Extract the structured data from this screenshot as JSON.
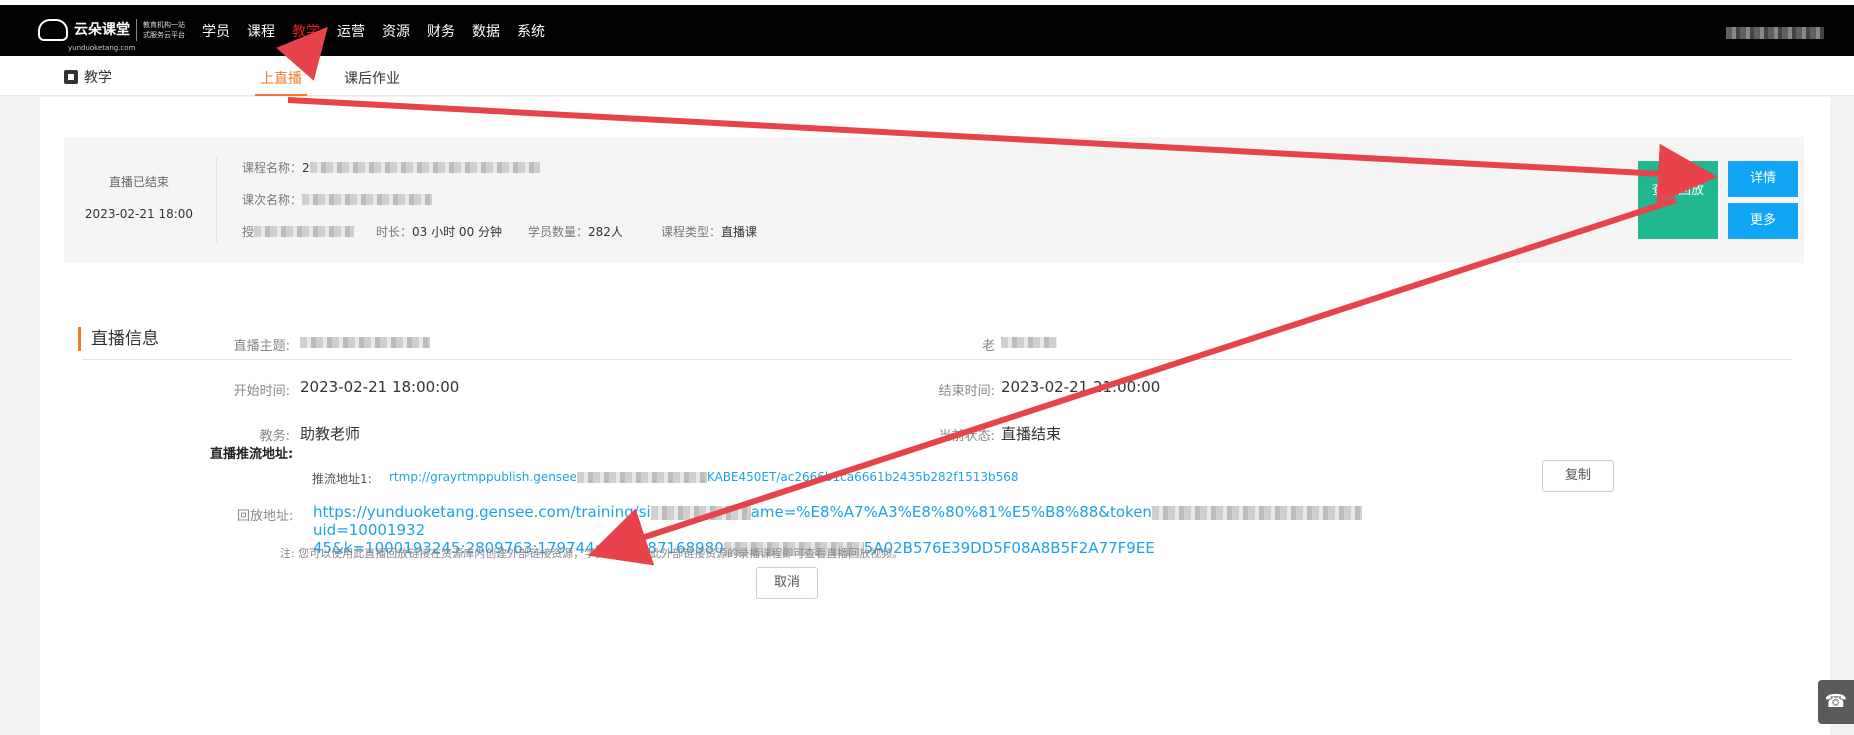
{
  "topbar": {
    "brand": "云朵课堂",
    "brand_sub": "yunduoketang.com",
    "slogan": "教育机构一站式服务云平台",
    "nav": [
      "学员",
      "课程",
      "教学",
      "运营",
      "资源",
      "财务",
      "数据",
      "系统"
    ],
    "active_nav": "教学"
  },
  "subbar": {
    "title": "教学",
    "tabs": [
      "上直播",
      "课后作业"
    ],
    "active_tab": "上直播"
  },
  "card": {
    "status": "直播已结束",
    "time": "2023-02-21 18:00",
    "course_name_label": "课程名称：",
    "course_name_value": "2",
    "session_name_label": "课次名称：",
    "teacher_label": "授",
    "duration_label": "时长：",
    "duration_value": "03 小时 00 分钟",
    "students_label": "学员数量：",
    "students_value": "282人",
    "type_label": "课程类型：",
    "type_value": "直播课",
    "replay_button": "查看回放",
    "detail_button": "详情",
    "more_button": "更多"
  },
  "live_info": {
    "section_title": "直播信息",
    "topic_label": "直播主题:",
    "teacher_label": "老",
    "start_label": "开始时间:",
    "start_value": "2023-02-21 18:00:00",
    "end_label": "结束时间:",
    "end_value": "2023-02-21 21:00:00",
    "assistant_label": "教务:",
    "assistant_value": "助教老师",
    "status_label": "当前状态:",
    "status_value": "直播结束",
    "push_title": "直播推流地址:",
    "push_label": "推流地址1:",
    "push_url_start": "rtmp://grayrtmppublish.gensee",
    "push_url_end": "KABE450ET/ac2666b1ca6661b2435b282f1513b568",
    "copy_button": "复制",
    "replay_label": "回放地址:",
    "replay_url_1a": "https://yunduoketang.gensee.com/training/si",
    "replay_url_1b": "ame=%E8%A7%A3%E8%80%81%E5%B8%88&token",
    "replay_url_1c": "uid=10001932",
    "replay_url_2a": "45&k=1000193245:2809763:179744:1676987168980",
    "replay_url_2b": "5A02B576E39DD5F08A8B5F2A77F9EE",
    "note": "注:  您可以使用此直播回放链接在资源库内创建外部链接资源，学员购买包含此外部链接资源的录播课程即可查看直播回放视频。",
    "cancel_button": "取消"
  },
  "colors": {
    "accent": "#f07a2a",
    "primary_button": "#10a5f5",
    "replay_button": "#21b791",
    "link": "#1ea1e8",
    "annotation_arrow": "#e8434a"
  }
}
